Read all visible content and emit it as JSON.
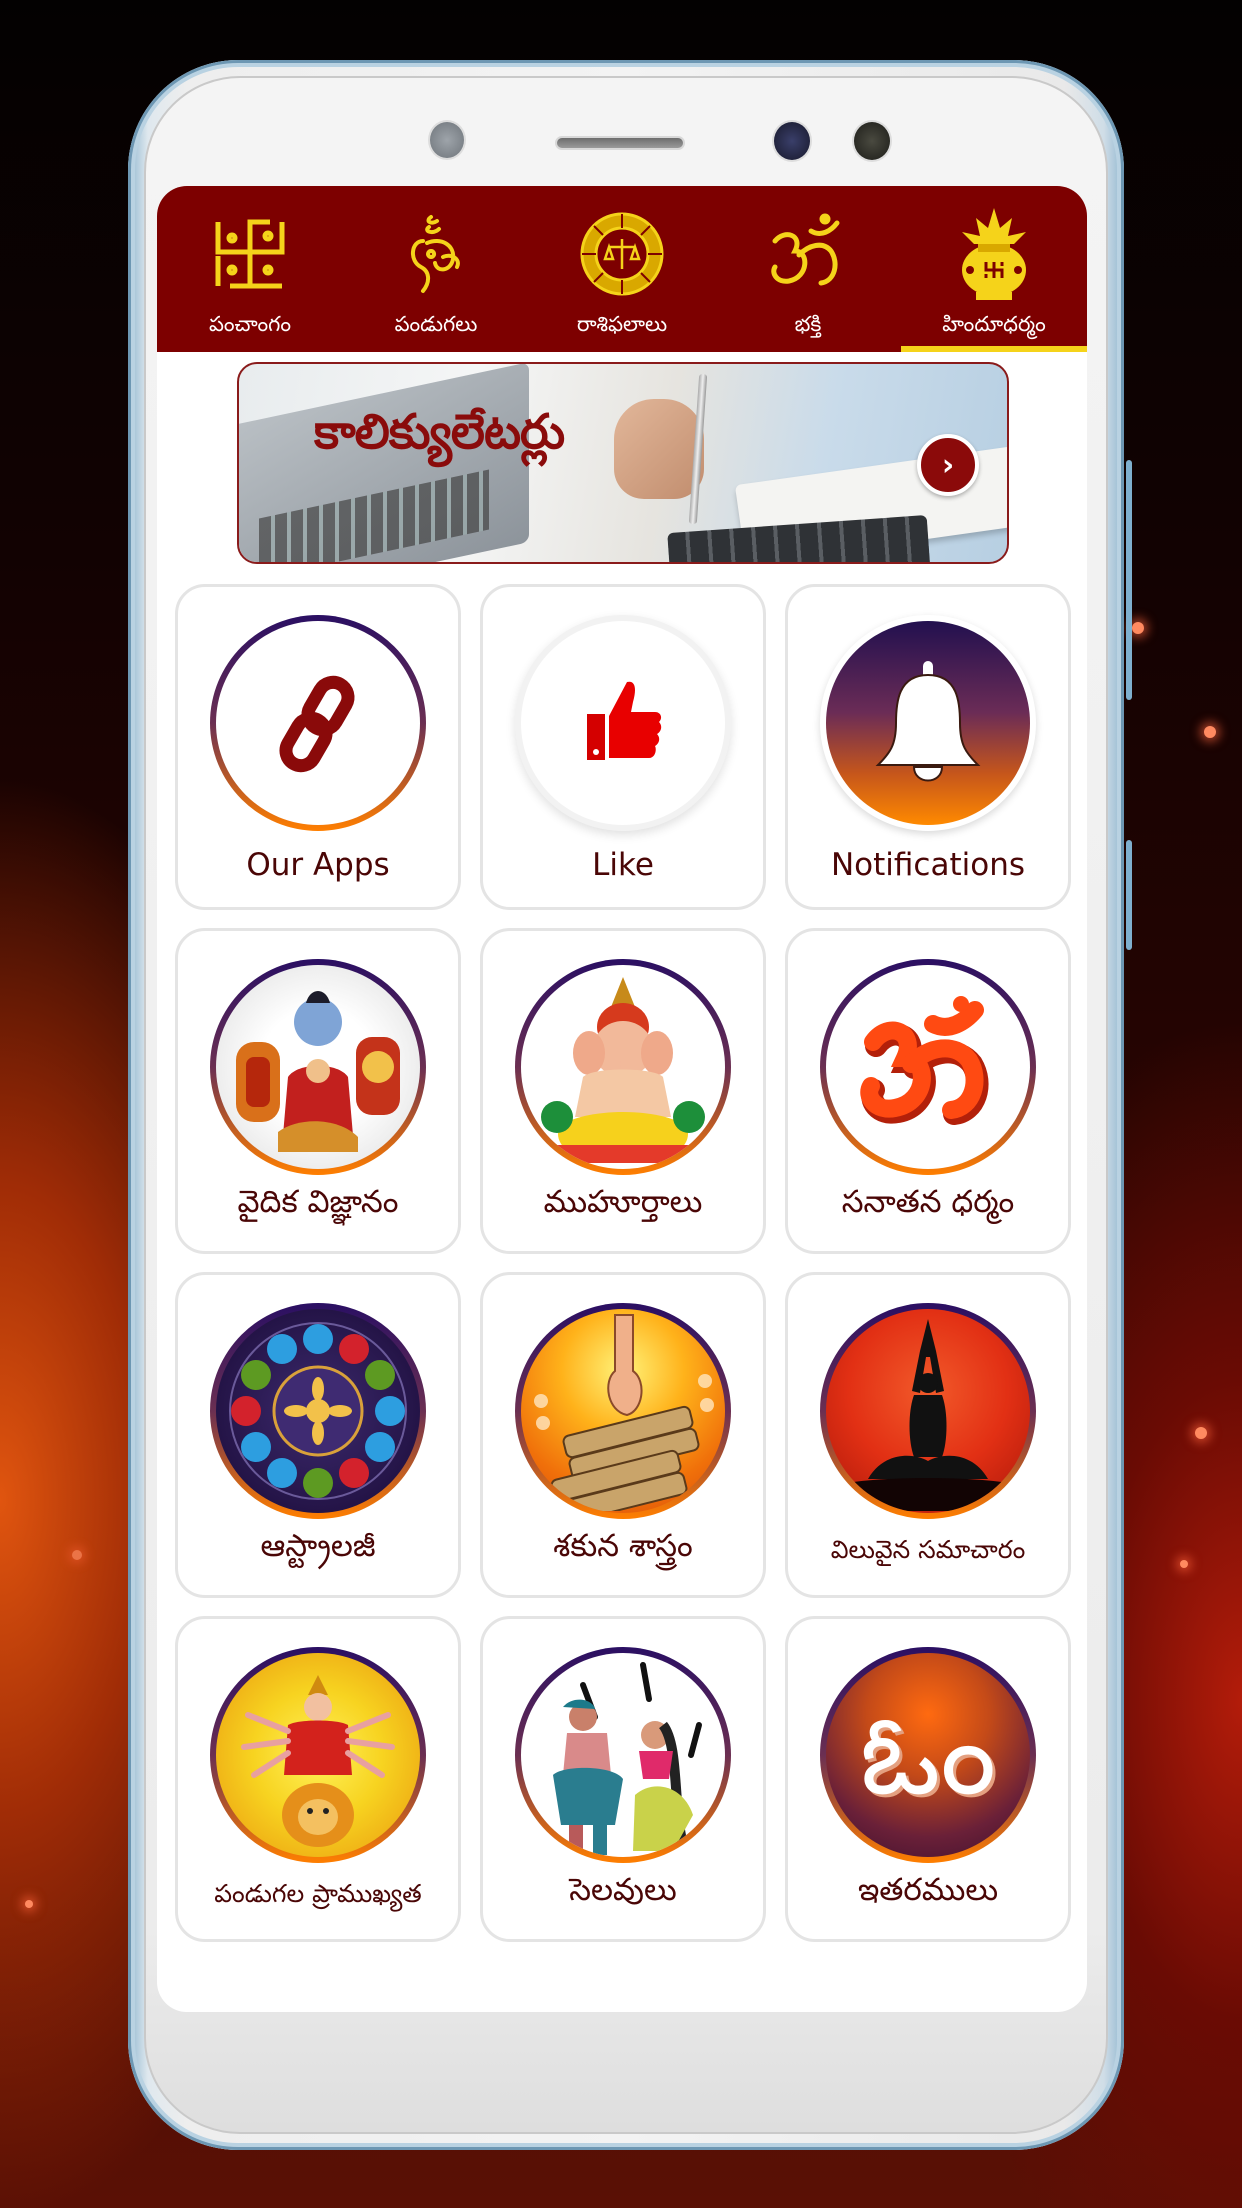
{
  "top_nav": {
    "items": [
      {
        "label": "పంచాంగం",
        "icon": "swastika-icon",
        "active": false
      },
      {
        "label": "పండుగలు",
        "icon": "ganesha-icon",
        "active": false
      },
      {
        "label": "రాశిఫలాలు",
        "icon": "zodiac-wheel-icon",
        "active": false
      },
      {
        "label": "భక్తి",
        "icon": "om-icon",
        "active": false
      },
      {
        "label": "హిందూధర్మం",
        "icon": "kalash-icon",
        "active": true
      }
    ]
  },
  "banner": {
    "title": "కాలిక్యులేటర్లు",
    "arrow_icon": "chevron-right-icon",
    "arrow_glyph": "›"
  },
  "tiles": [
    {
      "label": "Our Apps",
      "icon": "link-chain-icon"
    },
    {
      "label": "Like",
      "icon": "thumbs-up-icon"
    },
    {
      "label": "Notifications",
      "icon": "bell-icon"
    },
    {
      "label": "వైదిక విజ్ఞానం",
      "icon": "deities-collage-icon"
    },
    {
      "label": "ముహూర్తాలు",
      "icon": "ganesha-image-icon"
    },
    {
      "label": "సనాతన ధర్మం",
      "icon": "om-3d-icon"
    },
    {
      "label": "ఆస్ట్రాలజీ",
      "icon": "zodiac-wheel-image-icon"
    },
    {
      "label": "శకున శాస్త్రం",
      "icon": "palm-leaf-scripture-icon"
    },
    {
      "label": "విలువైన సమాచారం",
      "icon": "meditation-silhouette-icon"
    },
    {
      "label": "పండుగల ప్రాముఖ్యత",
      "icon": "durga-image-icon"
    },
    {
      "label": "సెలవులు",
      "icon": "dancers-image-icon"
    },
    {
      "label": "ఇతరములు",
      "icon": "telugu-om-icon",
      "glyph": "ఓం"
    }
  ],
  "colors": {
    "nav_bg": "#7d0000",
    "nav_icon": "#f5d31a",
    "active_underline": "#f5d31a",
    "label_text": "#4a0606",
    "ring_top": "#2a0f63",
    "ring_bottom": "#ff7f00"
  }
}
